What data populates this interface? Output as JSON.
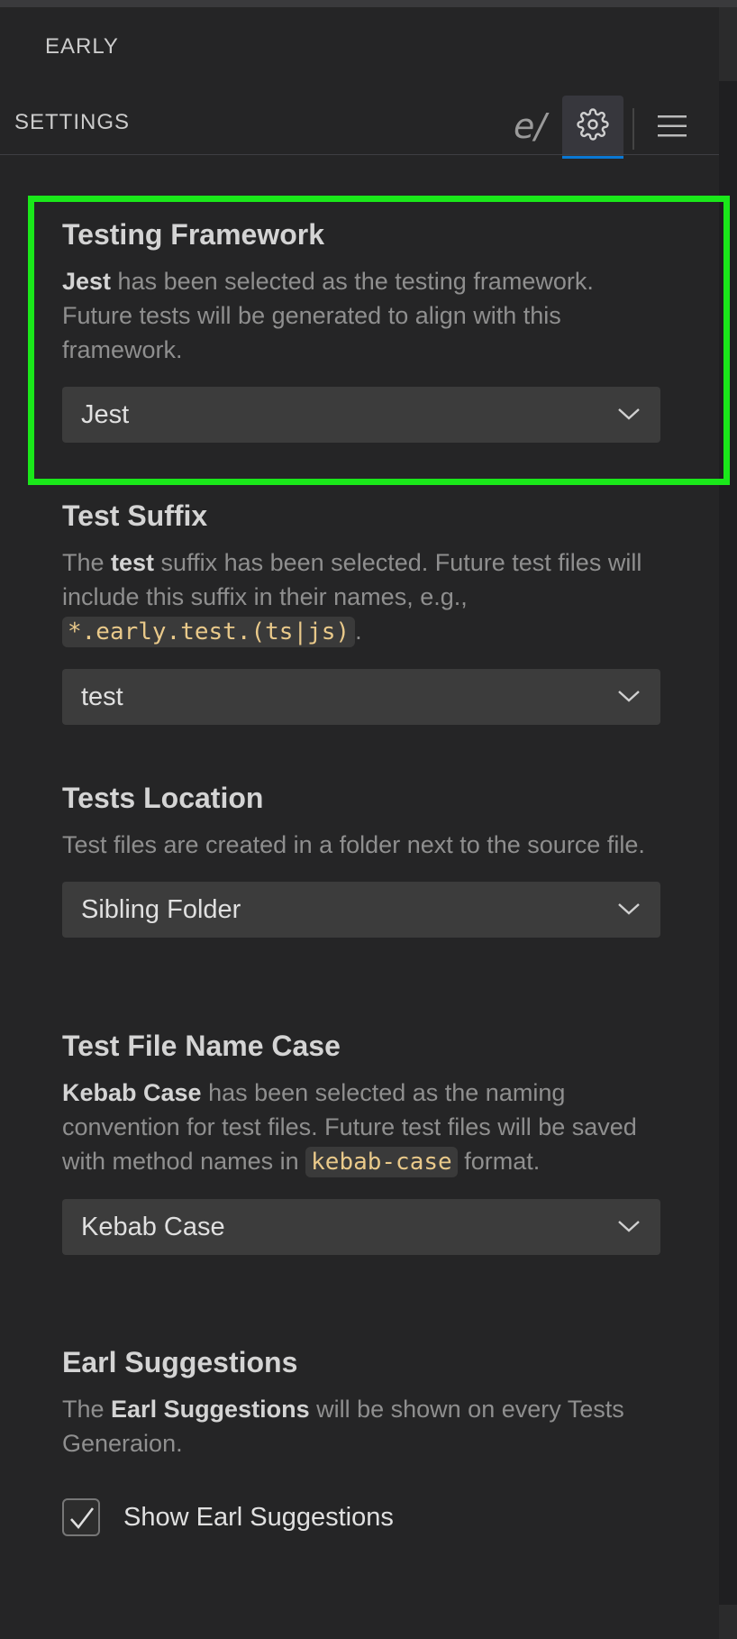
{
  "header": {
    "app_title": "EARLY",
    "panel_title": "SETTINGS",
    "logo_text": "e/",
    "icons": [
      "gear-icon",
      "menu-icon"
    ],
    "accent_color": "#0a78d4"
  },
  "sections": [
    {
      "title": "Testing Framework",
      "desc_bold": "Jest",
      "desc_rest": " has been selected as the testing framework. Future tests will be generated to align with this framework.",
      "select_value": "Jest"
    },
    {
      "title": "Test Suffix",
      "desc_pre": "The ",
      "desc_bold": "test",
      "desc_rest": " suffix has been selected. Future test files will include this suffix in their names, e.g., ",
      "code": "*.early.test.(ts|js)",
      "desc_end": ".",
      "select_value": "test"
    },
    {
      "title": "Tests Location",
      "desc": "Test files are created in a folder next to the source file.",
      "select_value": "Sibling Folder"
    },
    {
      "title": "Test File Name Case",
      "desc_bold": "Kebab Case",
      "desc_rest": " has been selected as the naming convention for test files. Future test files will be saved with method names in ",
      "code": "kebab-case",
      "desc_end": " format.",
      "select_value": "Kebab Case"
    },
    {
      "title": "Earl Suggestions",
      "desc_pre": "The ",
      "desc_bold": "Earl Suggestions",
      "desc_rest": " will be shown on every Tests Generaion.",
      "checkbox_label": "Show Earl Suggestions",
      "checked": true
    }
  ],
  "highlight_color": "#1ae81a"
}
